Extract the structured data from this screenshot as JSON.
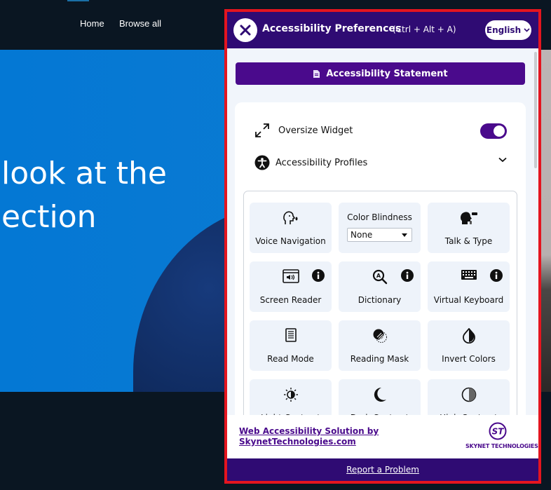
{
  "site": {
    "nav": [
      {
        "label": "Home"
      },
      {
        "label": "Browse all"
      }
    ],
    "hero": {
      "line1": "look at the",
      "line2": "ection"
    }
  },
  "widget": {
    "title": "Accessibility Preferences",
    "shortcut": "(Ctrl + Alt + A)",
    "language": "English",
    "statement_button": "Accessibility Statement",
    "oversize": {
      "label": "Oversize Widget",
      "enabled": true
    },
    "profiles": {
      "label": "Accessibility Profiles"
    },
    "tiles": [
      {
        "label": "Voice Navigation",
        "icon": "voice-navigation-icon",
        "info": false
      },
      {
        "label": "Color Blindness",
        "icon": "",
        "info": false,
        "select_value": "None"
      },
      {
        "label": "Talk & Type",
        "icon": "talk-type-icon",
        "info": false
      },
      {
        "label": "Screen Reader",
        "icon": "screen-reader-icon",
        "info": true
      },
      {
        "label": "Dictionary",
        "icon": "dictionary-icon",
        "info": true
      },
      {
        "label": "Virtual Keyboard",
        "icon": "keyboard-icon",
        "info": true
      },
      {
        "label": "Read Mode",
        "icon": "read-mode-icon",
        "info": false
      },
      {
        "label": "Reading Mask",
        "icon": "reading-mask-icon",
        "info": false
      },
      {
        "label": "Invert Colors",
        "icon": "invert-colors-icon",
        "info": false
      },
      {
        "label": "Light Contrast",
        "icon": "light-contrast-icon",
        "info": false
      },
      {
        "label": "Dark Contrast",
        "icon": "dark-contrast-icon",
        "info": false
      },
      {
        "label": "High Contrast",
        "icon": "high-contrast-icon",
        "info": false
      }
    ],
    "footer": {
      "brand_link_line1": "Web Accessibility Solution by",
      "brand_link_line2": "SkynetTechnologies.com",
      "logo_mark": "ST",
      "logo_name": "SKYNET TECHNOLOGIES",
      "report": "Report a Problem"
    },
    "colors": {
      "primary": "#2f0b73",
      "button": "#4a0a8c",
      "frame_highlight": "#e4151f"
    }
  }
}
